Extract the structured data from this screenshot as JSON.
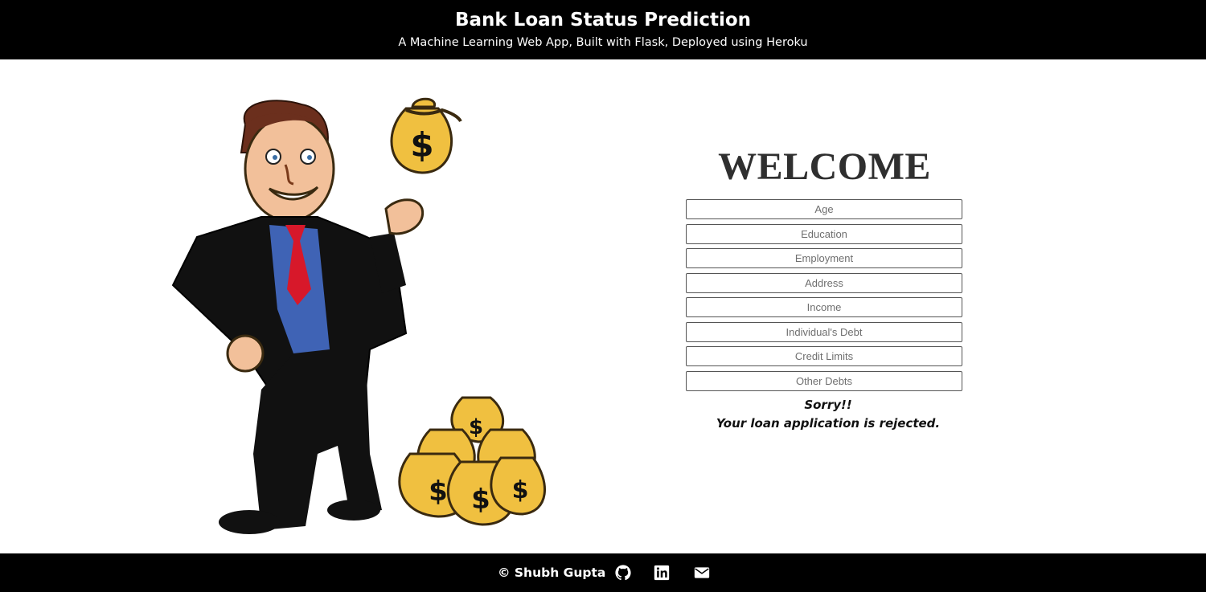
{
  "header": {
    "title": "Bank Loan Status Prediction",
    "subtitle": "A Machine Learning Web App, Built with Flask, Deployed using Heroku"
  },
  "main": {
    "welcome": "WELCOME",
    "fields": [
      {
        "placeholder": "Age"
      },
      {
        "placeholder": "Education"
      },
      {
        "placeholder": "Employment"
      },
      {
        "placeholder": "Address"
      },
      {
        "placeholder": "Income"
      },
      {
        "placeholder": "Individual's Debt"
      },
      {
        "placeholder": "Credit Limits"
      },
      {
        "placeholder": "Other Debts"
      }
    ],
    "result_line1": "Sorry!!",
    "result_line2": "Your loan application is rejected."
  },
  "footer": {
    "copyright": "© Shubh Gupta",
    "icons": [
      "github-icon",
      "linkedin-icon",
      "email-icon"
    ]
  },
  "colors": {
    "bar": "#000000",
    "bag": "#f0c040",
    "suit": "#111111",
    "vest": "#3f63b5",
    "tie": "#d7182a"
  }
}
